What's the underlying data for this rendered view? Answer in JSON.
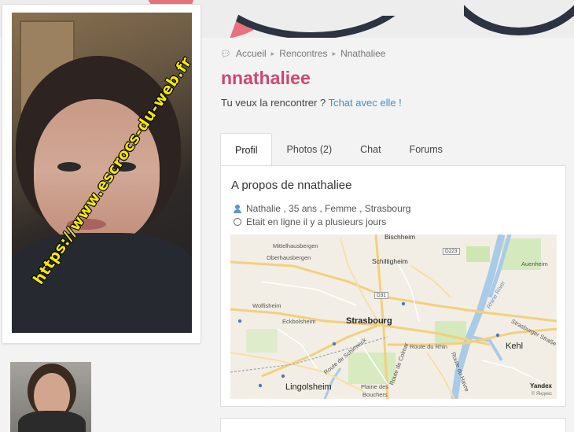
{
  "breadcrumb": {
    "home": "Accueil",
    "section": "Rencontres",
    "current": "Nnathaliee"
  },
  "profile": {
    "username": "nnathaliee",
    "tagline_prefix": "Tu veux la rencontrer ? ",
    "tagline_link": "Tchat avec elle !",
    "watermark": "https://www.escrocs-du-web.fr"
  },
  "tabs": [
    {
      "label": "Profil",
      "active": true
    },
    {
      "label": "Photos (2)",
      "active": false
    },
    {
      "label": "Chat",
      "active": false
    },
    {
      "label": "Forums",
      "active": false
    }
  ],
  "about": {
    "title": "A propos de nnathaliee",
    "details": "Nathalie , 35 ans , Femme , Strasbourg",
    "status": "Etait en ligne il y a plusieurs jours"
  },
  "map": {
    "labels": {
      "bischheim": "Bischheim",
      "mittelhausbergen": "Mittelhausbergen",
      "oberhausbergen": "Oberhausbergen",
      "schiltigheim": "Schiltigheim",
      "auenheim": "Auenheim",
      "wolfisheim": "Wolfisheim",
      "eckbolsheim": "Eckbolsheim",
      "strasbourg": "Strasbourg",
      "kehl": "Kehl",
      "lingolsheim": "Lingolsheim",
      "plaine": "Plaine des",
      "bouchers": "Bouchers",
      "route_schirmeck": "Route de Schirmeck",
      "route_rhin": "Route du Rhin",
      "route_colmar": "Route de Colmar",
      "route_havre": "Route du Havre",
      "strasburger": "Strasburger Straße",
      "rhine": "Rhine River",
      "d223": "D223",
      "d31": "D31"
    },
    "provider": "Yandex",
    "provider_sub": "© Яндекс"
  },
  "colors": {
    "accent_pink": "#d1466e",
    "link_blue": "#3f8fc9",
    "banner_red": "#e7727c",
    "banner_dark": "#2b3440",
    "watermark_yellow": "#f5e900"
  }
}
